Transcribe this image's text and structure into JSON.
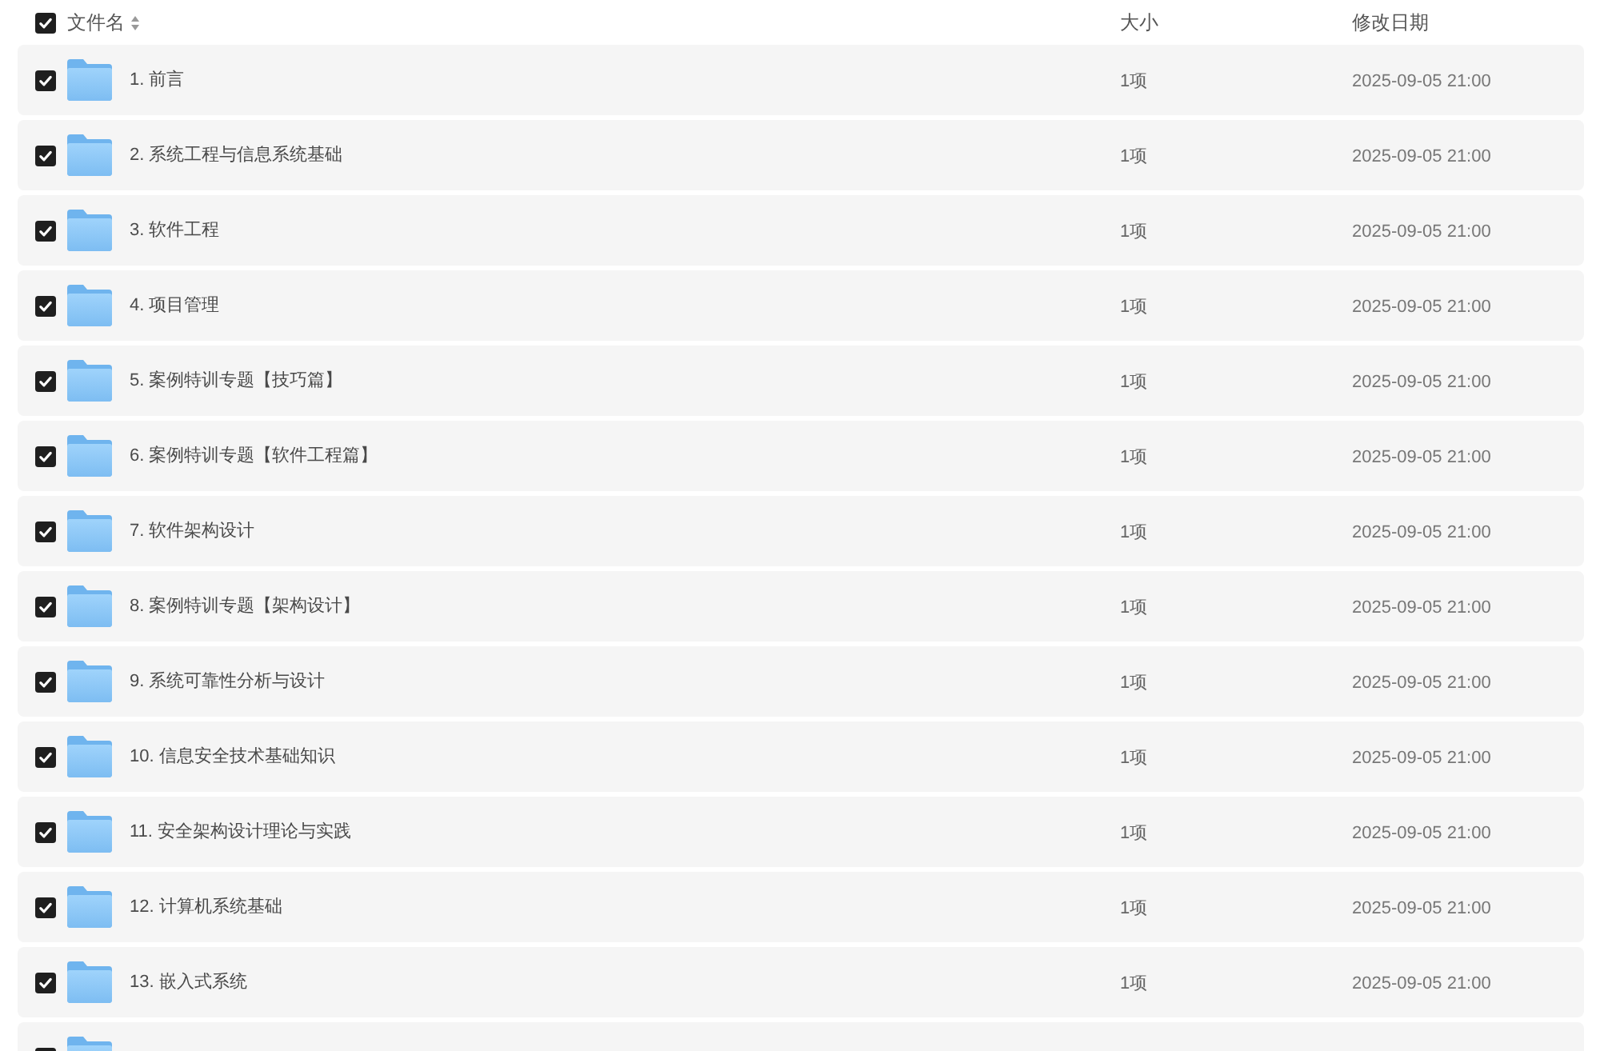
{
  "header": {
    "checked": true,
    "columns": [
      {
        "label": "文件名",
        "sortable": true
      },
      {
        "label": "大小",
        "sortable": false
      },
      {
        "label": "修改日期",
        "sortable": false
      }
    ]
  },
  "rows": [
    {
      "checked": true,
      "name": "1. 前言",
      "size": "1项",
      "modified": "2025-09-05 21:00"
    },
    {
      "checked": true,
      "name": "2. 系统工程与信息系统基础",
      "size": "1项",
      "modified": "2025-09-05 21:00"
    },
    {
      "checked": true,
      "name": "3. 软件工程",
      "size": "1项",
      "modified": "2025-09-05 21:00"
    },
    {
      "checked": true,
      "name": "4. 项目管理",
      "size": "1项",
      "modified": "2025-09-05 21:00"
    },
    {
      "checked": true,
      "name": "5. 案例特训专题【技巧篇】",
      "size": "1项",
      "modified": "2025-09-05 21:00"
    },
    {
      "checked": true,
      "name": "6. 案例特训专题【软件工程篇】",
      "size": "1项",
      "modified": "2025-09-05 21:00"
    },
    {
      "checked": true,
      "name": "7. 软件架构设计",
      "size": "1项",
      "modified": "2025-09-05 21:00"
    },
    {
      "checked": true,
      "name": "8. 案例特训专题【架构设计】",
      "size": "1项",
      "modified": "2025-09-05 21:00"
    },
    {
      "checked": true,
      "name": "9. 系统可靠性分析与设计",
      "size": "1项",
      "modified": "2025-09-05 21:00"
    },
    {
      "checked": true,
      "name": "10. 信息安全技术基础知识",
      "size": "1项",
      "modified": "2025-09-05 21:00"
    },
    {
      "checked": true,
      "name": "11. 安全架构设计理论与实践",
      "size": "1项",
      "modified": "2025-09-05 21:00"
    },
    {
      "checked": true,
      "name": "12. 计算机系统基础",
      "size": "1项",
      "modified": "2025-09-05 21:00"
    },
    {
      "checked": true,
      "name": "13. 嵌入式系统",
      "size": "1项",
      "modified": "2025-09-05 21:00"
    },
    {
      "checked": true
    }
  ]
}
